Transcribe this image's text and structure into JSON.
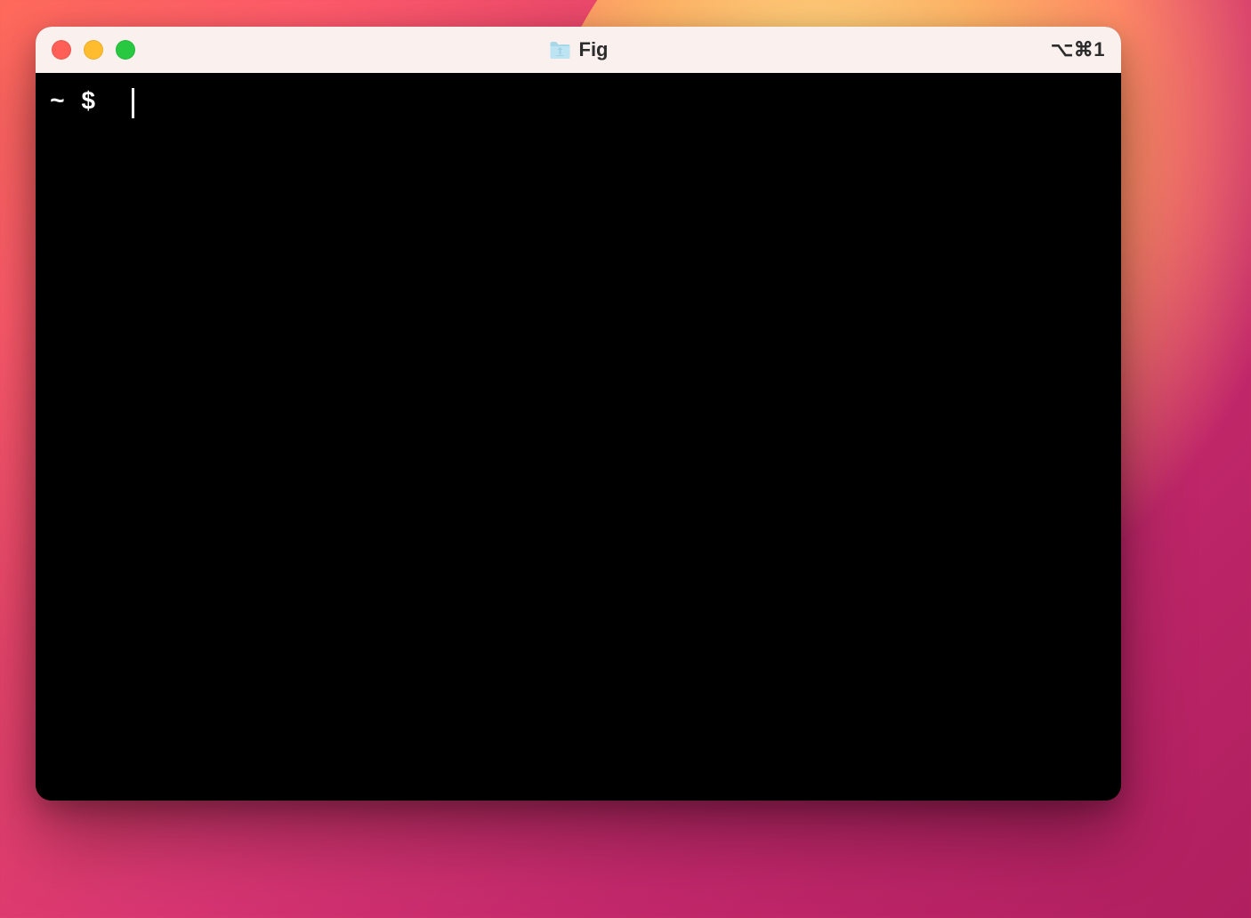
{
  "window": {
    "title": "Fig",
    "shortcut_glyphs": "⌥⌘1",
    "colors": {
      "titlebar_bg": "#faf1ef",
      "terminal_bg": "#000000",
      "text": "#ffffff",
      "close": "#ff5f57",
      "minimize": "#febc2e",
      "zoom": "#28c840"
    }
  },
  "prompt": {
    "cwd": "~",
    "symbol": "$",
    "input_value": ""
  }
}
